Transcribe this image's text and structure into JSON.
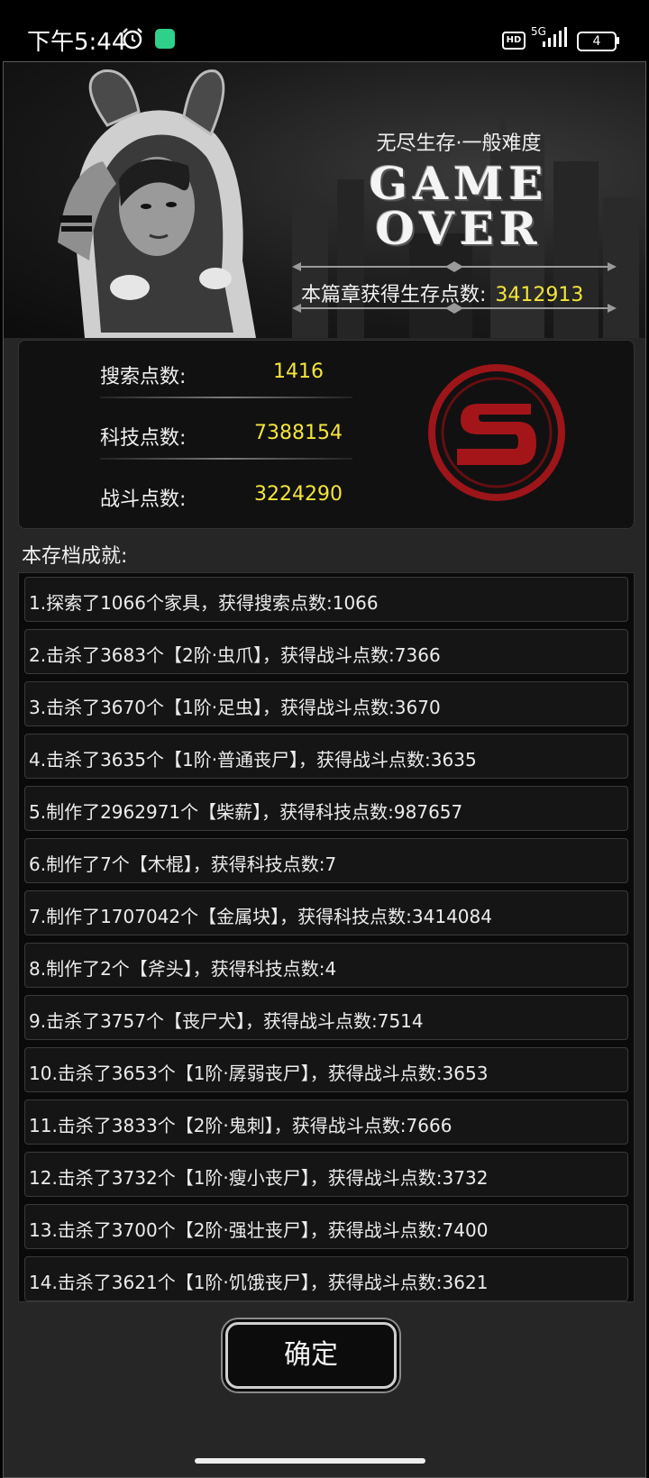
{
  "status_bar": {
    "time": "下午5:44",
    "hd": "HD",
    "network": "5G",
    "battery": "4"
  },
  "banner": {
    "mode": "无尽生存·一般难度",
    "gameover_line1": "GAME",
    "gameover_line2": "OVER",
    "chapter_points_label": "本篇章获得生存点数:",
    "chapter_points_value": "3412913"
  },
  "stats": [
    {
      "label": "搜索点数:",
      "value": "1416"
    },
    {
      "label": "科技点数:",
      "value": "7388154"
    },
    {
      "label": "战斗点数:",
      "value": "3224290"
    }
  ],
  "logo_icon": "red-s-emblem-icon",
  "achievements_title": "本存档成就:",
  "achievements": [
    "1.探索了1066个家具，获得搜索点数:1066",
    "2.击杀了3683个【2阶·虫爪】，获得战斗点数:7366",
    "3.击杀了3670个【1阶·足虫】，获得战斗点数:3670",
    "4.击杀了3635个【1阶·普通丧尸】，获得战斗点数:3635",
    "5.制作了2962971个【柴薪】，获得科技点数:987657",
    "6.制作了7个【木棍】，获得科技点数:7",
    "7.制作了1707042个【金属块】，获得科技点数:3414084",
    "8.制作了2个【斧头】，获得科技点数:4",
    "9.击杀了3757个【丧尸犬】，获得战斗点数:7514",
    "10.击杀了3653个【1阶·孱弱丧尸】，获得战斗点数:3653",
    "11.击杀了3833个【2阶·鬼刺】，获得战斗点数:7666",
    "12.击杀了3732个【1阶·瘦小丧尸】，获得战斗点数:3732",
    "13.击杀了3700个【2阶·强壮丧尸】，获得战斗点数:7400",
    "14.击杀了3621个【1阶·饥饿丧尸】，获得战斗点数:3621"
  ],
  "confirm_label": "确定",
  "colors": {
    "highlight": "#f3e53a",
    "emblem_red": "#b5161b"
  }
}
